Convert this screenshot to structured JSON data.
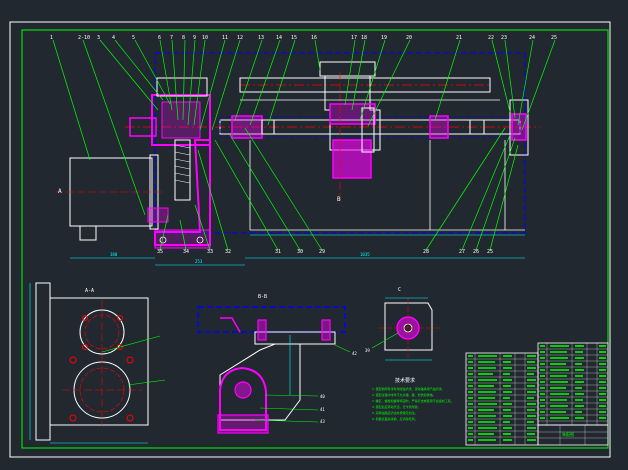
{
  "balloons": [
    "1",
    "2-10",
    "3",
    "4",
    "5",
    "6",
    "7",
    "8",
    "9",
    "10",
    "11",
    "12",
    "13",
    "14",
    "15",
    "16",
    "17",
    "18",
    "19",
    "20",
    "21",
    "22",
    "23",
    "24",
    "25",
    "26",
    "27",
    "28"
  ],
  "bottom_balloons": [
    "35",
    "34",
    "33",
    "32",
    "31",
    "30",
    "29",
    "28",
    "27",
    "26",
    "25",
    "24",
    "23",
    "22",
    "21",
    "20"
  ],
  "section_mark": "A",
  "view_mark": "B",
  "dims": {
    "top_total": "1035",
    "top_left": "150",
    "top_mid": "253",
    "motor_w": "380",
    "left_h": "270",
    "left_w": "250",
    "left_w2": "200",
    "mid_h": "115",
    "right_w": "175",
    "right_h": "100"
  },
  "view_titles": {
    "a": "A-A",
    "b": "B-B",
    "c": "C"
  },
  "part_callouts": [
    "42",
    "40",
    "41",
    "43",
    "39",
    "38"
  ],
  "tech_title": "技术要求",
  "tech_notes": [
    "1.装配前所有零件用煤油清洗，滚动轴承用汽油清洗。",
    "2.装配过程中零件不允许磕、碰、划伤和锈蚀。",
    "3.螺钉、螺栓和螺母紧固时，严禁打击或使用不合适的工具。",
    "4.装配后应转动灵活，无卡滞现象。",
    "5.润滑油脂应清洁并按规定加注。",
    "6.机器表面涂漆前，应清除毛刺。"
  ],
  "title_block_name": "装配图",
  "colors": {
    "background": "#212830",
    "frame": "#ffffff",
    "part": "#ff00ff",
    "leader": "#00ff00",
    "centerline": "#ff0000",
    "hidden": "#0000ff",
    "dimension": "#00ffff",
    "outline": "#ffffff"
  }
}
